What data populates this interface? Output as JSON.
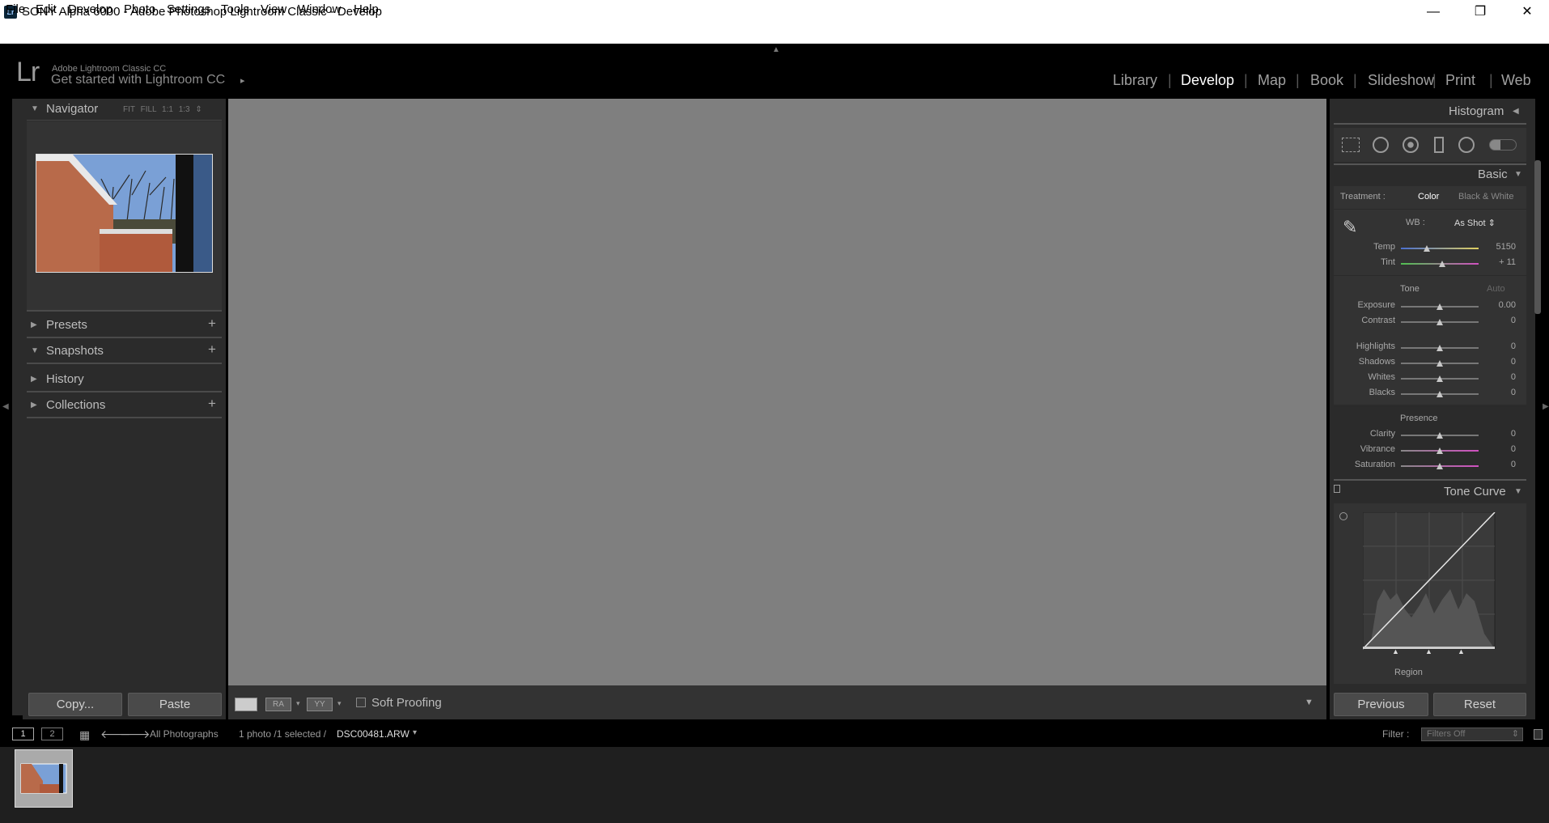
{
  "window": {
    "title": "SONY Alpha 6000 - Adobe Photoshop Lightroom Classic - Develop",
    "app_icon": "Lr",
    "minimize": "—",
    "maximize": "❐",
    "close": "✕"
  },
  "menubar": [
    "File",
    "Edit",
    "Develop",
    "Photo",
    "Settings",
    "Tools",
    "View",
    "Window",
    "Help"
  ],
  "identity": {
    "logo": "Lr",
    "small": "Adobe Lightroom Classic CC",
    "big": "Get started with Lightroom CC",
    "arrow": "▸"
  },
  "modules": [
    "Library",
    "Develop",
    "Map",
    "Book",
    "Slideshow",
    "Print",
    "Web"
  ],
  "active_module": "Develop",
  "left_panel": {
    "navigator": {
      "title": "Navigator",
      "options": "FIT FILL 1:1 1:3 ⇕"
    },
    "presets": "Presets",
    "snapshots": "Snapshots",
    "history": "History",
    "collections": "Collections",
    "add": "+",
    "copy": "Copy...",
    "paste": "Paste"
  },
  "toolbar": {
    "soft_proofing": "Soft Proofing",
    "view_ra": "RA",
    "view_yy": "YY"
  },
  "right_panel": {
    "histogram": "Histogram",
    "basic": "Basic",
    "treatment_label": "Treatment :",
    "treatment_color": "Color",
    "treatment_bw": "Black & White",
    "wb_label": "WB :",
    "wb_value": "As Shot ⇕",
    "tone": "Tone",
    "auto": "Auto",
    "presence": "Presence",
    "tone_curve": "Tone Curve",
    "region": "Region",
    "previous": "Previous",
    "reset": "Reset",
    "sliders": [
      {
        "label": "Temp",
        "value": "5150",
        "pos": 0.33
      },
      {
        "label": "Tint",
        "value": "+ 11",
        "pos": 0.53
      },
      {
        "label": "Exposure",
        "value": "0.00",
        "pos": 0.5
      },
      {
        "label": "Contrast",
        "value": "0",
        "pos": 0.5
      },
      {
        "label": "Highlights",
        "value": "0",
        "pos": 0.5
      },
      {
        "label": "Shadows",
        "value": "0",
        "pos": 0.5
      },
      {
        "label": "Whites",
        "value": "0",
        "pos": 0.5
      },
      {
        "label": "Blacks",
        "value": "0",
        "pos": 0.5
      },
      {
        "label": "Clarity",
        "value": "0",
        "pos": 0.5
      },
      {
        "label": "Vibrance",
        "value": "0",
        "pos": 0.5
      },
      {
        "label": "Saturation",
        "value": "0",
        "pos": 0.5
      }
    ]
  },
  "filmstrip": {
    "screen1": "1",
    "screen2": "2",
    "source": "All Photographs",
    "count": "1 photo /1 selected /",
    "filename": "DSC00481.ARW",
    "filter_label": "Filter :",
    "filter_value": "Filters Off"
  },
  "colors": {
    "accent_text": "#ffffff",
    "panel": "#2b2b2b",
    "canvas": "#7f7f7f"
  }
}
